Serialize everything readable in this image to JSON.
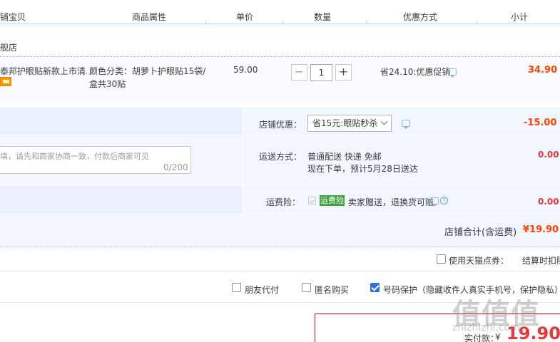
{
  "header": {
    "col_item": "铺宝贝",
    "col_attr": "商品属性",
    "col_price": "单价",
    "col_qty": "数量",
    "col_promo": "优惠方式",
    "col_subtotal": "小计"
  },
  "shop": {
    "name": "舰店"
  },
  "item": {
    "title": "泰邦护眼贴新款上市清...",
    "badge_icon": "credit-card-icon",
    "attr": "颜色分类：胡萝卜护眼贴15袋/盒共30贴",
    "unit_price": "59.00",
    "qty_minus": "−",
    "qty_value": "1",
    "qty_plus": "+",
    "promo": "省24.10:优惠促销",
    "subtotal": "34.90"
  },
  "shop_options": {
    "memo_placeholder": "填，请先和商家协商一致，付款后商家可见",
    "memo_count": "0/200",
    "discount_label": "店铺优惠：",
    "discount_selected": "省15元:眼贴秒杀",
    "discount_amount": "-15.00",
    "shipping_label": "运送方式：",
    "shipping_line1": "普通配送 快递 免邮",
    "shipping_line2": "现在下单，预计5月28日送达",
    "shipping_amount": "0.00",
    "insurance_label": "运费险：",
    "insurance_tag": "运费险",
    "insurance_text": "卖家赠送，退换货可赔",
    "insurance_help": "?",
    "insurance_amount": "0.00",
    "shop_total_label": "店铺合计(含运费)",
    "shop_total": "¥19.90"
  },
  "options": {
    "tmall_points": "使用天猫点券：",
    "settle_deduct": "结算时扣除",
    "friend_pay": "朋友代付",
    "anonymous": "匿名购买",
    "number_protect": "号码保护（隐藏收件人真实手机号，保护隐私）"
  },
  "payment": {
    "label": "实付款：",
    "currency": "¥",
    "amount": "19.90"
  },
  "watermark": {
    "text": "值值值",
    "url": "zhizhizhi.com"
  },
  "colors": {
    "accent_red": "#ff4400",
    "total_red": "#e4393c",
    "panel_blue": "#f2f7ff",
    "checkbox_blue": "#2e6fd9"
  }
}
